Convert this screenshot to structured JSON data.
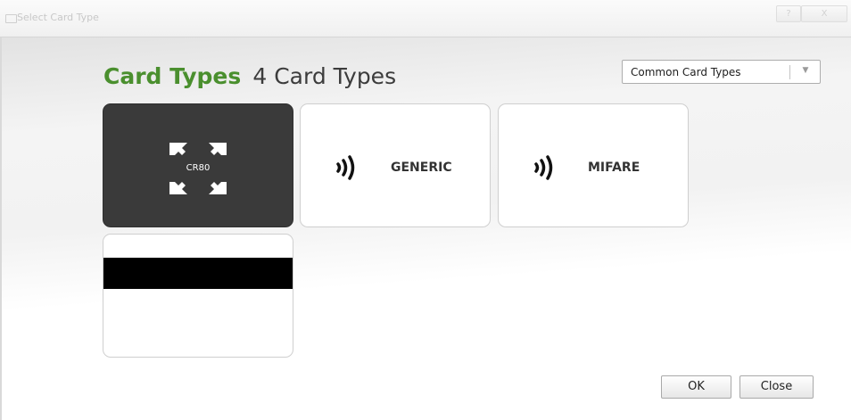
{
  "window": {
    "title": "Select Card Type",
    "help_label": "?",
    "close_label": "X"
  },
  "header": {
    "title": "Card Types",
    "count": "4 Card Types"
  },
  "filter": {
    "selected": "Common Card Types",
    "arrow_icon": "chevron-down-icon"
  },
  "cards": [
    {
      "label": "CR80",
      "icon": "expand-arrows-icon",
      "selected": true
    },
    {
      "label": "GENERIC",
      "icon": "rfid-wave-icon",
      "selected": false
    },
    {
      "label": "MIFARE",
      "icon": "rfid-wave-icon",
      "selected": false
    },
    {
      "label": "",
      "icon": "magnetic-stripe",
      "selected": false
    }
  ],
  "footer": {
    "ok_label": "OK",
    "close_label": "Close"
  },
  "colors": {
    "accent_green": "#4a8f2e",
    "selected_card": "#3a3a3a"
  }
}
